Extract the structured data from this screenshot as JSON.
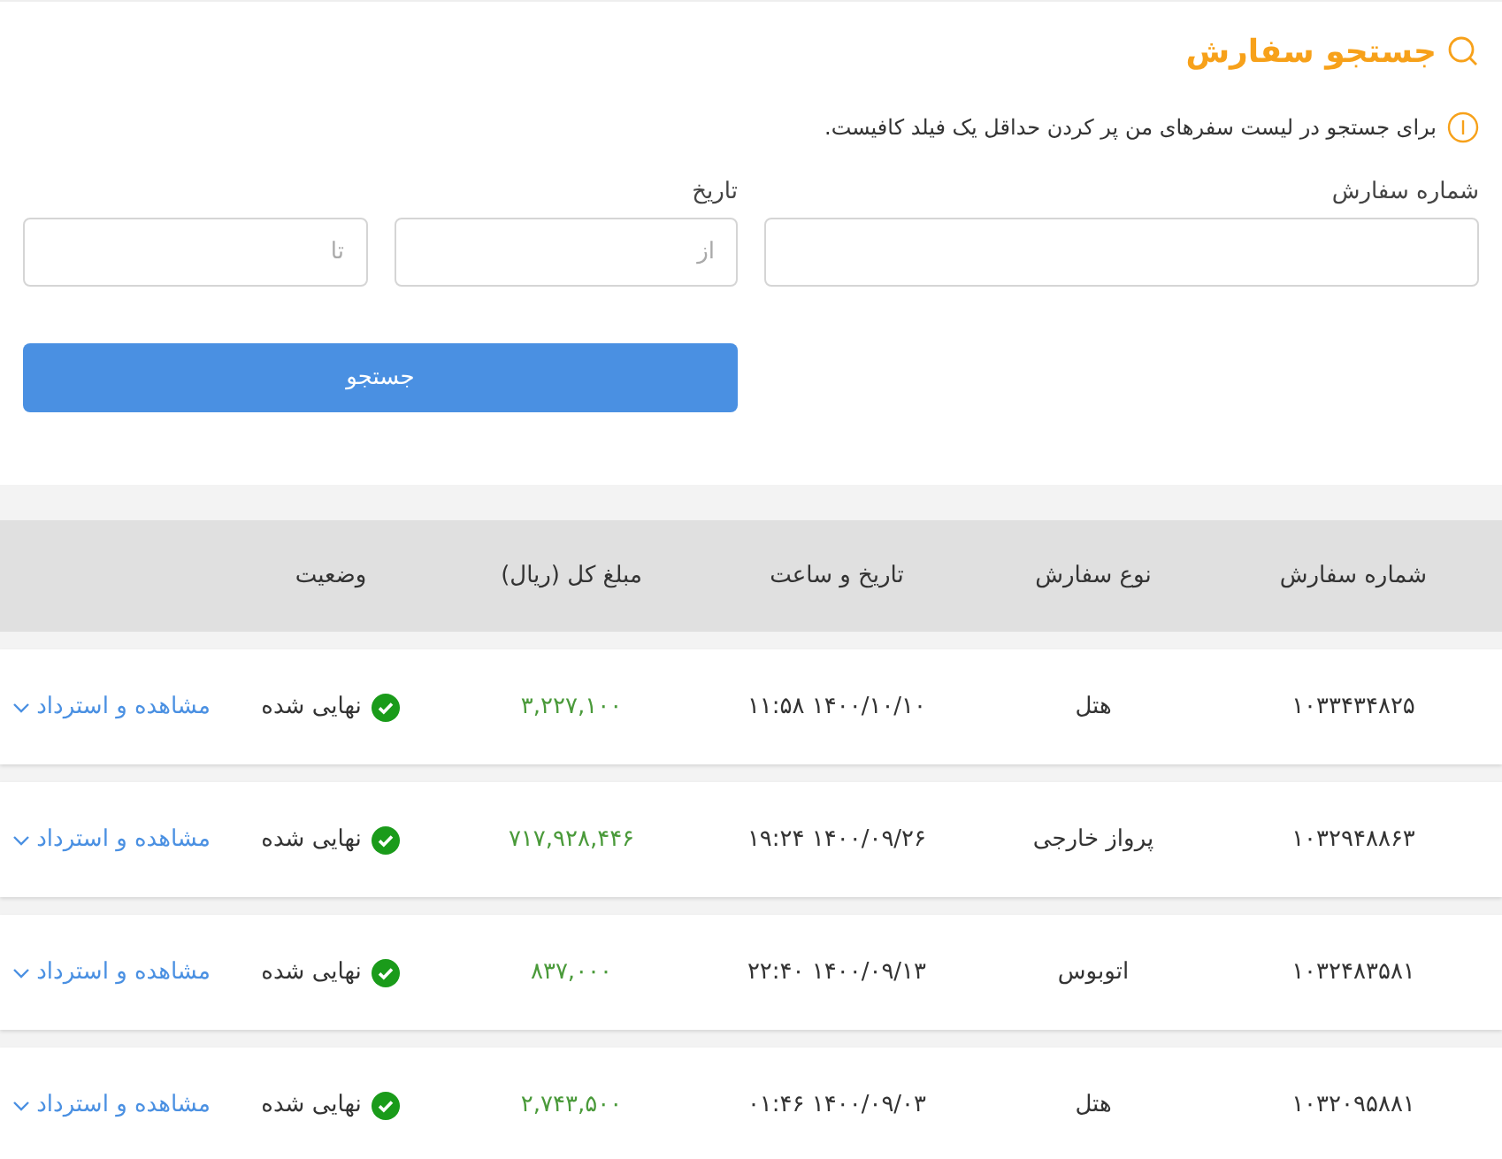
{
  "search_panel": {
    "title": "جستجو سفارش",
    "info": "برای جستجو در لیست سفرهای من پر کردن حداقل یک فیلد کافیست.",
    "order_field": {
      "label": "شماره سفارش"
    },
    "date_field": {
      "label": "تاریخ",
      "from_placeholder": "از",
      "to_placeholder": "تا"
    },
    "search_button": "جستجو"
  },
  "table": {
    "columns": [
      "شماره سفارش",
      "نوع سفارش",
      "تاریخ و ساعت",
      "مبلغ کل (ریال)",
      "وضعیت"
    ],
    "rows": [
      {
        "order_number": "۱۰۳۳۴۳۴۸۲۵",
        "type": "هتل",
        "datetime": "۱۴۰۰/۱۰/۱۰ ۱۱:۵۸",
        "amount": "۳,۲۲۷,۱۰۰",
        "status": {
          "kind": "done",
          "label": "نهایی شده"
        },
        "action": "مشاهده و استرداد"
      },
      {
        "order_number": "۱۰۳۲۹۴۸۸۶۳",
        "type": "پرواز خارجی",
        "datetime": "۱۴۰۰/۰۹/۲۶ ۱۹:۲۴",
        "amount": "۷۱۷,۹۲۸,۴۴۶",
        "status": {
          "kind": "done",
          "label": "نهایی شده"
        },
        "action": "مشاهده و استرداد"
      },
      {
        "order_number": "۱۰۳۲۴۸۳۵۸۱",
        "type": "اتوبوس",
        "datetime": "۱۴۰۰/۰۹/۱۳ ۲۲:۴۰",
        "amount": "۸۳۷,۰۰۰",
        "status": {
          "kind": "done",
          "label": "نهایی شده"
        },
        "action": "مشاهده و استرداد"
      },
      {
        "order_number": "۱۰۳۲۰۹۵۸۸۱",
        "type": "هتل",
        "datetime": "۱۴۰۰/۰۹/۰۳ ۰۱:۴۶",
        "amount": "۲,۷۴۳,۵۰۰",
        "status": {
          "kind": "done",
          "label": "نهایی شده"
        },
        "action": "مشاهده و استرداد"
      }
    ]
  }
}
